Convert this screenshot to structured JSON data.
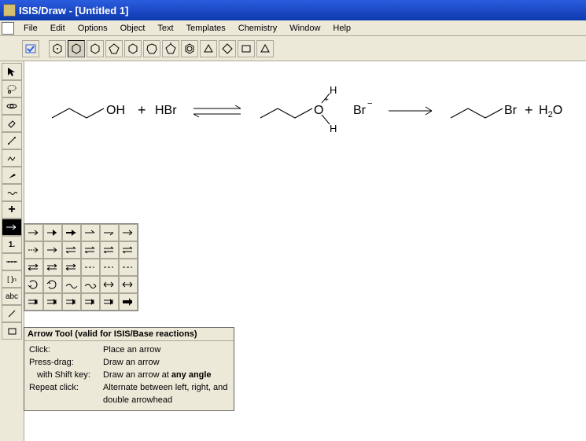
{
  "window": {
    "title": "ISIS/Draw - [Untitled 1]"
  },
  "menu": {
    "items": [
      "File",
      "Edit",
      "Options",
      "Object",
      "Text",
      "Templates",
      "Chemistry",
      "Window",
      "Help"
    ]
  },
  "top_toolbar": {
    "icons": [
      "check-rect",
      "hex-dot",
      "hex-fill",
      "hexagon",
      "pentagon",
      "hexagon2",
      "cycloheptane",
      "cyclopentadiene",
      "benzene",
      "cyclopropane",
      "cyclobutane",
      "rect",
      "triangle"
    ]
  },
  "left_toolbar": {
    "items": [
      {
        "name": "pointer-tool",
        "label": "",
        "selected": false
      },
      {
        "name": "lasso-tool",
        "label": "",
        "selected": false
      },
      {
        "name": "atom-tool",
        "label": "",
        "selected": false
      },
      {
        "name": "eraser-tool",
        "label": "",
        "selected": false
      },
      {
        "name": "bond-tool",
        "label": "",
        "selected": false
      },
      {
        "name": "chain-tool",
        "label": "",
        "selected": false
      },
      {
        "name": "wedge-tool",
        "label": "",
        "selected": false
      },
      {
        "name": "wavy-tool",
        "label": "",
        "selected": false
      },
      {
        "name": "plus-tool",
        "label": "+",
        "selected": false
      },
      {
        "name": "arrow-tool",
        "label": "→",
        "selected": true
      },
      {
        "name": "map-tool",
        "label": "1.",
        "selected": false
      },
      {
        "name": "sequence-tool",
        "label": "↔",
        "selected": false
      },
      {
        "name": "bracket-tool",
        "label": "[]n",
        "selected": false
      },
      {
        "name": "text-tool",
        "label": "abc",
        "selected": false
      },
      {
        "name": "line-tool",
        "label": "",
        "selected": false
      },
      {
        "name": "rect-tool",
        "label": "",
        "selected": false
      }
    ]
  },
  "flyout": {
    "rows": 5,
    "cols": 6,
    "arrow_types": [
      "r",
      "r",
      "r",
      "r",
      "r",
      "r",
      "rd",
      "r",
      "rev",
      "rev",
      "rev",
      "rev",
      "eq",
      "eq",
      "eq",
      "dash",
      "dash",
      "dash",
      "cyc",
      "cyc",
      "wavy",
      "wavy",
      "dbl",
      "dbl",
      "dr",
      "dr",
      "dr",
      "dr",
      "dr",
      "thick"
    ]
  },
  "tooltip": {
    "title": "Arrow Tool (valid for ISIS/Base reactions)",
    "rows": [
      {
        "k": "Click:",
        "v": "Place an arrow",
        "indent": false
      },
      {
        "k": "Press-drag:",
        "v": "Draw an arrow",
        "indent": false
      },
      {
        "k": "with Shift key:",
        "v": "Draw an arrow at <b>any angle</b>",
        "indent": true
      },
      {
        "k": "Repeat click:",
        "v": "Alternate between left, right, and double arrowhead",
        "indent": false
      }
    ]
  },
  "reaction": {
    "reactant1": "OH",
    "plus1": "+",
    "reagent": "HBr",
    "intermediate_O": "O",
    "intermediate_H_top": "H",
    "intermediate_H_bot": "H",
    "intermediate_charge": "+",
    "counterion": "Br",
    "counterion_charge": "−",
    "product": "Br",
    "plus2": "+",
    "byproduct": "H2O",
    "byproduct_sub": "2"
  }
}
